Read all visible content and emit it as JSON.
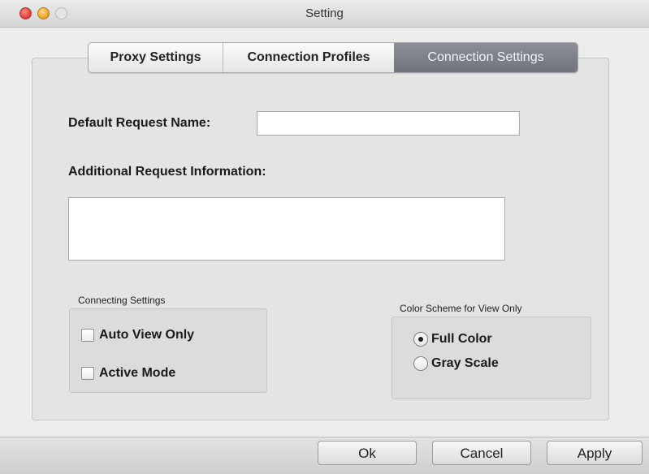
{
  "window": {
    "title": "Setting"
  },
  "tabs": [
    {
      "label": "Proxy Settings",
      "selected": false
    },
    {
      "label": "Connection Profiles",
      "selected": false
    },
    {
      "label": "Connection Settings",
      "selected": true
    }
  ],
  "form": {
    "default_request_name_label": "Default Request Name:",
    "default_request_name_value": "",
    "additional_info_label": "Additional Request Information:",
    "additional_info_value": ""
  },
  "connecting_settings": {
    "title": "Connecting Settings",
    "options": [
      {
        "label": "Auto View Only",
        "checked": false
      },
      {
        "label": "Active Mode",
        "checked": false
      }
    ]
  },
  "color_scheme": {
    "title": "Color Scheme for View Only",
    "options": [
      {
        "label": "Full Color",
        "selected": true
      },
      {
        "label": "Gray Scale",
        "selected": false
      }
    ]
  },
  "buttons": {
    "ok": "Ok",
    "cancel": "Cancel",
    "apply": "Apply"
  }
}
